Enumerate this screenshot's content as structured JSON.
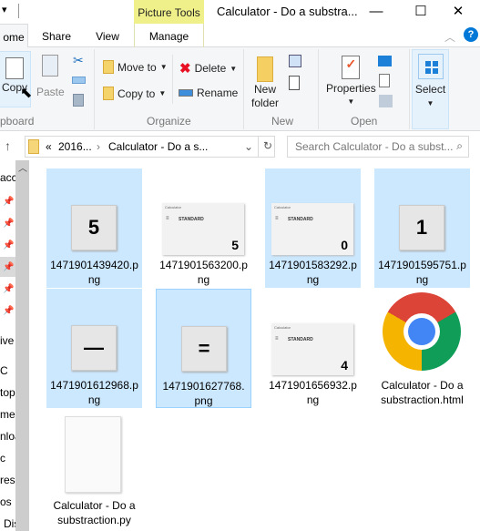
{
  "window": {
    "title": "Calculator - Do a substra...",
    "context_tab": "Picture Tools"
  },
  "tabs": [
    "ome",
    "Share",
    "View",
    "Manage"
  ],
  "ribbon": {
    "clipboard": {
      "label": "pboard",
      "copy": "Copy",
      "paste": "Paste"
    },
    "organize": {
      "label": "Organize",
      "move_to": "Move to",
      "copy_to": "Copy to",
      "delete": "Delete",
      "rename": "Rename"
    },
    "new": {
      "label": "New",
      "new_folder_1": "New",
      "new_folder_2": "folder"
    },
    "open": {
      "label": "Open",
      "properties": "Properties"
    },
    "select": {
      "label": "Select"
    }
  },
  "address": {
    "prefix": "«",
    "crumbs": [
      "2016...",
      "Calculator - Do a s..."
    ]
  },
  "search": {
    "placeholder": "Search Calculator - Do a subst..."
  },
  "nav": [
    "acc",
    "ive",
    "C",
    "top",
    "me",
    "nloa",
    "c",
    "res",
    "os",
    "Dis"
  ],
  "files": [
    {
      "name": "1471901439420.png",
      "thumb": "key",
      "value": "5",
      "selected": true
    },
    {
      "name": "1471901563200.png",
      "thumb": "calc",
      "value": "5",
      "selected": false
    },
    {
      "name": "1471901583292.png",
      "thumb": "calc",
      "value": "0",
      "selected": true
    },
    {
      "name": "1471901595751.png",
      "thumb": "key",
      "value": "1",
      "selected": true
    },
    {
      "name": "1471901612968.png",
      "thumb": "key",
      "value": "—",
      "selected": true
    },
    {
      "name": "1471901627768.png",
      "thumb": "key",
      "value": "=",
      "selected": true,
      "focused": true
    },
    {
      "name": "1471901656932.png",
      "thumb": "calc",
      "value": "4",
      "selected": false
    },
    {
      "name": "Calculator - Do a substraction.html",
      "thumb": "chrome",
      "selected": false
    },
    {
      "name": "Calculator - Do a substraction.py",
      "thumb": "file",
      "selected": false
    }
  ],
  "calc_thumb": {
    "title": "Calculator",
    "mode": "STANDARD"
  },
  "colors": {
    "selection": "#cce8ff",
    "context_tab": "#f0f08a",
    "accent": "#0078d7"
  }
}
